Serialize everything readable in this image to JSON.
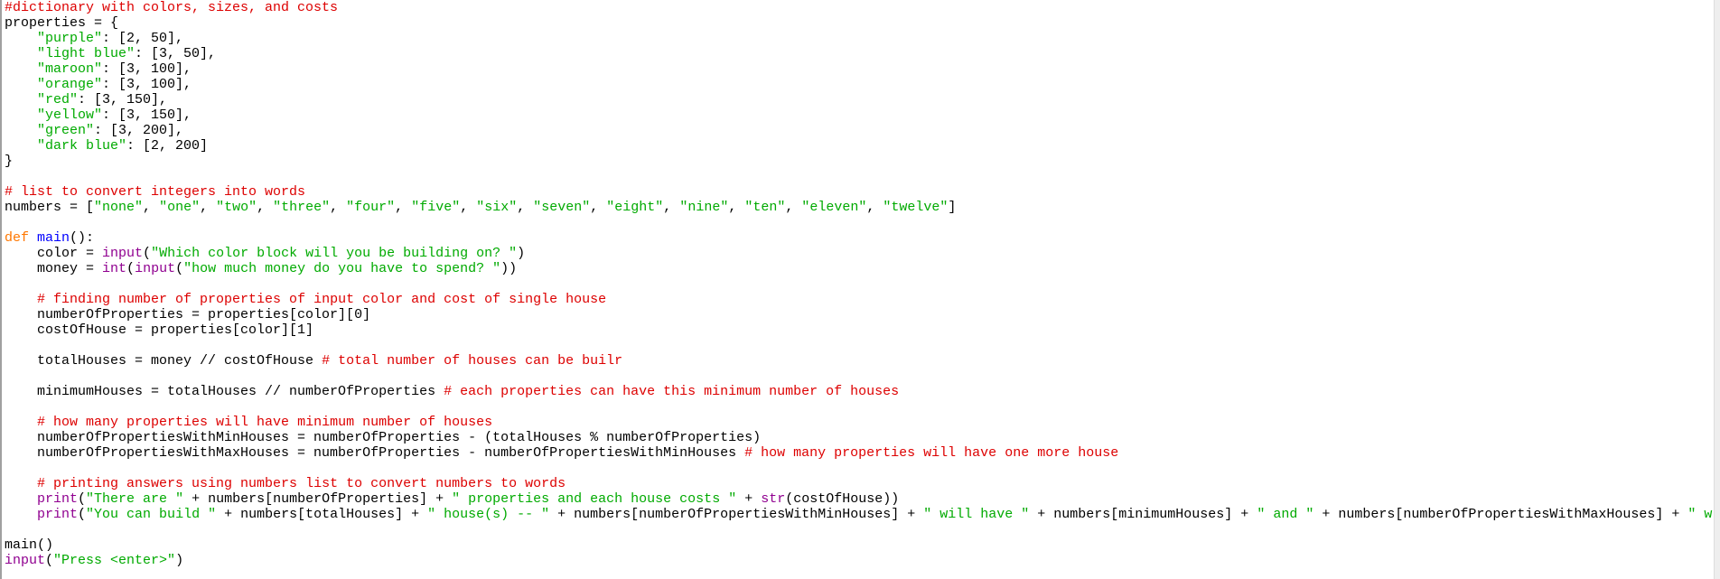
{
  "editor": {
    "colors": {
      "comment": "#dd0000",
      "string": "#00aa00",
      "keyword": "#ff7700",
      "defname": "#0000ff",
      "builtin": "#900090",
      "plain": "#000000"
    },
    "lines": [
      [
        [
          "comment",
          "#dictionary with colors, sizes, and costs"
        ]
      ],
      [
        [
          "plain",
          "properties = {"
        ]
      ],
      [
        [
          "plain",
          "    "
        ],
        [
          "string",
          "\"purple\""
        ],
        [
          "plain",
          ": [2, 50],"
        ]
      ],
      [
        [
          "plain",
          "    "
        ],
        [
          "string",
          "\"light blue\""
        ],
        [
          "plain",
          ": [3, 50],"
        ]
      ],
      [
        [
          "plain",
          "    "
        ],
        [
          "string",
          "\"maroon\""
        ],
        [
          "plain",
          ": [3, 100],"
        ]
      ],
      [
        [
          "plain",
          "    "
        ],
        [
          "string",
          "\"orange\""
        ],
        [
          "plain",
          ": [3, 100],"
        ]
      ],
      [
        [
          "plain",
          "    "
        ],
        [
          "string",
          "\"red\""
        ],
        [
          "plain",
          ": [3, 150],"
        ]
      ],
      [
        [
          "plain",
          "    "
        ],
        [
          "string",
          "\"yellow\""
        ],
        [
          "plain",
          ": [3, 150],"
        ]
      ],
      [
        [
          "plain",
          "    "
        ],
        [
          "string",
          "\"green\""
        ],
        [
          "plain",
          ": [3, 200],"
        ]
      ],
      [
        [
          "plain",
          "    "
        ],
        [
          "string",
          "\"dark blue\""
        ],
        [
          "plain",
          ": [2, 200]"
        ]
      ],
      [
        [
          "plain",
          "}"
        ]
      ],
      [],
      [
        [
          "comment",
          "# list to convert integers into words"
        ]
      ],
      [
        [
          "plain",
          "numbers = ["
        ],
        [
          "string",
          "\"none\""
        ],
        [
          "plain",
          ", "
        ],
        [
          "string",
          "\"one\""
        ],
        [
          "plain",
          ", "
        ],
        [
          "string",
          "\"two\""
        ],
        [
          "plain",
          ", "
        ],
        [
          "string",
          "\"three\""
        ],
        [
          "plain",
          ", "
        ],
        [
          "string",
          "\"four\""
        ],
        [
          "plain",
          ", "
        ],
        [
          "string",
          "\"five\""
        ],
        [
          "plain",
          ", "
        ],
        [
          "string",
          "\"six\""
        ],
        [
          "plain",
          ", "
        ],
        [
          "string",
          "\"seven\""
        ],
        [
          "plain",
          ", "
        ],
        [
          "string",
          "\"eight\""
        ],
        [
          "plain",
          ", "
        ],
        [
          "string",
          "\"nine\""
        ],
        [
          "plain",
          ", "
        ],
        [
          "string",
          "\"ten\""
        ],
        [
          "plain",
          ", "
        ],
        [
          "string",
          "\"eleven\""
        ],
        [
          "plain",
          ", "
        ],
        [
          "string",
          "\"twelve\""
        ],
        [
          "plain",
          "]"
        ]
      ],
      [],
      [
        [
          "keyword",
          "def "
        ],
        [
          "defname",
          "main"
        ],
        [
          "plain",
          "():"
        ]
      ],
      [
        [
          "plain",
          "    color = "
        ],
        [
          "builtin",
          "input"
        ],
        [
          "plain",
          "("
        ],
        [
          "string",
          "\"Which color block will you be building on? \""
        ],
        [
          "plain",
          ")"
        ]
      ],
      [
        [
          "plain",
          "    money = "
        ],
        [
          "builtin",
          "int"
        ],
        [
          "plain",
          "("
        ],
        [
          "builtin",
          "input"
        ],
        [
          "plain",
          "("
        ],
        [
          "string",
          "\"how much money do you have to spend? \""
        ],
        [
          "plain",
          "))"
        ]
      ],
      [],
      [
        [
          "plain",
          "    "
        ],
        [
          "comment",
          "# finding number of properties of input color and cost of single house"
        ]
      ],
      [
        [
          "plain",
          "    numberOfProperties = properties[color][0]"
        ]
      ],
      [
        [
          "plain",
          "    costOfHouse = properties[color][1]"
        ]
      ],
      [],
      [
        [
          "plain",
          "    totalHouses = money // costOfHouse "
        ],
        [
          "comment",
          "# total number of houses can be builr"
        ]
      ],
      [],
      [
        [
          "plain",
          "    minimumHouses = totalHouses // numberOfProperties "
        ],
        [
          "comment",
          "# each properties can have this minimum number of houses"
        ]
      ],
      [],
      [
        [
          "plain",
          "    "
        ],
        [
          "comment",
          "# how many properties will have minimum number of houses"
        ]
      ],
      [
        [
          "plain",
          "    numberOfPropertiesWithMinHouses = numberOfProperties - (totalHouses % numberOfProperties)"
        ]
      ],
      [
        [
          "plain",
          "    numberOfPropertiesWithMaxHouses = numberOfProperties - numberOfPropertiesWithMinHouses "
        ],
        [
          "comment",
          "# how many properties will have one more house"
        ]
      ],
      [],
      [
        [
          "plain",
          "    "
        ],
        [
          "comment",
          "# printing answers using numbers list to convert numbers to words"
        ]
      ],
      [
        [
          "plain",
          "    "
        ],
        [
          "builtin",
          "print"
        ],
        [
          "plain",
          "("
        ],
        [
          "string",
          "\"There are \""
        ],
        [
          "plain",
          " + numbers[numberOfProperties] + "
        ],
        [
          "string",
          "\" properties and each house costs \""
        ],
        [
          "plain",
          " + "
        ],
        [
          "builtin",
          "str"
        ],
        [
          "plain",
          "(costOfHouse))"
        ]
      ],
      [
        [
          "plain",
          "    "
        ],
        [
          "builtin",
          "print"
        ],
        [
          "plain",
          "("
        ],
        [
          "string",
          "\"You can build \""
        ],
        [
          "plain",
          " + numbers[totalHouses] + "
        ],
        [
          "string",
          "\" house(s) -- \""
        ],
        [
          "plain",
          " + numbers[numberOfPropertiesWithMinHouses] + "
        ],
        [
          "string",
          "\" will have \""
        ],
        [
          "plain",
          " + numbers[minimumHouses] + "
        ],
        [
          "string",
          "\" and \""
        ],
        [
          "plain",
          " + numbers[numberOfPropertiesWithMaxHouses] + "
        ],
        [
          "string",
          "\" w"
        ]
      ],
      [],
      [
        [
          "plain",
          "main()"
        ]
      ],
      [
        [
          "builtin",
          "input"
        ],
        [
          "plain",
          "("
        ],
        [
          "string",
          "\"Press <enter>\""
        ],
        [
          "plain",
          ")"
        ]
      ]
    ]
  }
}
